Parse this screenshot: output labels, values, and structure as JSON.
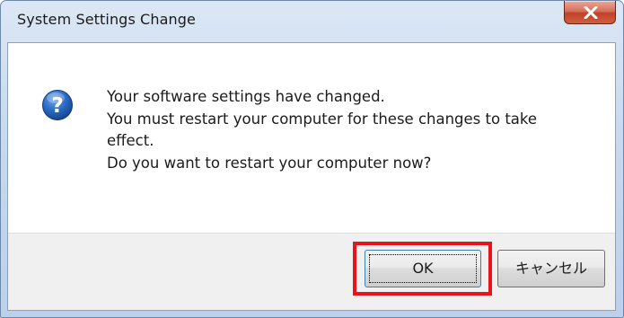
{
  "window": {
    "title": "System Settings Change"
  },
  "dialog": {
    "icon": "question-icon",
    "message_lines": [
      "Your software settings have changed.",
      "You must restart your computer for these changes to take",
      "effect.",
      "Do you want to restart your computer now?"
    ]
  },
  "buttons": {
    "ok_label": "OK",
    "cancel_label": "キャンセル"
  },
  "colors": {
    "highlight": "#e8141c",
    "close_button": "#c0412a",
    "icon_blue": "#1f5fb8"
  }
}
